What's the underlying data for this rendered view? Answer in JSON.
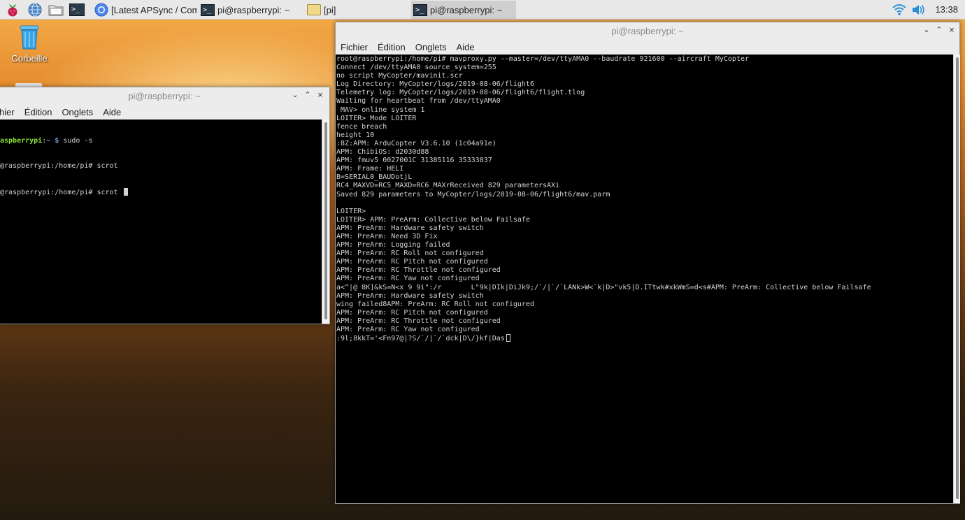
{
  "taskbar": {
    "tasks": [
      {
        "label": "[Latest APSync / Com..."
      },
      {
        "label": "pi@raspberrypi: ~"
      },
      {
        "label": "[pi]"
      },
      {
        "label": "pi@raspberrypi: ~"
      }
    ],
    "clock": "13:38"
  },
  "desktop": {
    "trash_label": "Corbeille"
  },
  "left_window": {
    "title": "pi@raspberrypi: ~",
    "menus": [
      "hier",
      "Édition",
      "Onglets",
      "Aide"
    ],
    "prompt_user": "aspberrypi",
    "prompt_sep": ":",
    "prompt_dir": "~ $",
    "prompt_cmd": " sudo -s",
    "lines": [
      "@raspberrypi:/home/pi# scrot",
      "@raspberrypi:/home/pi# scrot "
    ]
  },
  "right_window": {
    "title": "pi@raspberrypi: ~",
    "menus": [
      "Fichier",
      "Édition",
      "Onglets",
      "Aide"
    ],
    "lines": [
      "root@raspberrypi:/home/pi# mavproxy.py --master=/dev/ttyAMA0 --baudrate 921600 --aircraft MyCopter",
      "Connect /dev/ttyAMA0 source_system=255",
      "no script MyCopter/mavinit.scr",
      "Log Directory: MyCopter/logs/2019-08-06/flight6",
      "Telemetry log: MyCopter/logs/2019-08-06/flight6/flight.tlog",
      "Waiting for heartbeat from /dev/ttyAMA0",
      " MAV> online system 1",
      "LOITER> Mode LOITER",
      "fence breach",
      "height 10",
      ":8Z:APM: ArduCopter V3.6.10 (1c04a91e)",
      "APM: ChibiOS: d2030d88",
      "APM: fmuv5 0027001C 31385116 35333837",
      "APM: Frame: HELI",
      "B=SERIAL0_BAUDotjL",
      "RC4_MAXVD=RC5_MAXD=RC6_MAXrReceived 829 parametersAXi",
      "Saved 829 parameters to MyCopter/logs/2019-08-06/flight6/mav.parm",
      "",
      "LOITER>",
      "LOITER> APM: PreArm: Collective below Failsafe",
      "APM: PreArm: Hardware safety switch",
      "APM: PreArm: Need 3D Fix",
      "APM: PreArm: Logging failed",
      "APM: PreArm: RC Roll not configured",
      "APM: PreArm: RC Pitch not configured",
      "APM: PreArm: RC Throttle not configured",
      "APM: PreArm: RC Yaw not configured",
      "a<^|@ 8K]&kS=N<x 9 9i\":/r       L\"9k|DIk|DiJk9;/`/|`/`LANk>W<`k|D>\"vk5|D.ITtwk#xkWmS=d<s#APM: PreArm: Collective below Failsafe",
      "APM: PreArm: Hardware safety switch",
      "wing failed8APM: PreArm: RC Roll not configured",
      "APM: PreArm: RC Pitch not configured",
      "APM: PreArm: RC Throttle not configured",
      "APM: PreArm: RC Yaw not configured",
      ":9l;8kkT='<Fn97@|?S/`/|`/`dck|D\\/}kf|Das"
    ]
  }
}
